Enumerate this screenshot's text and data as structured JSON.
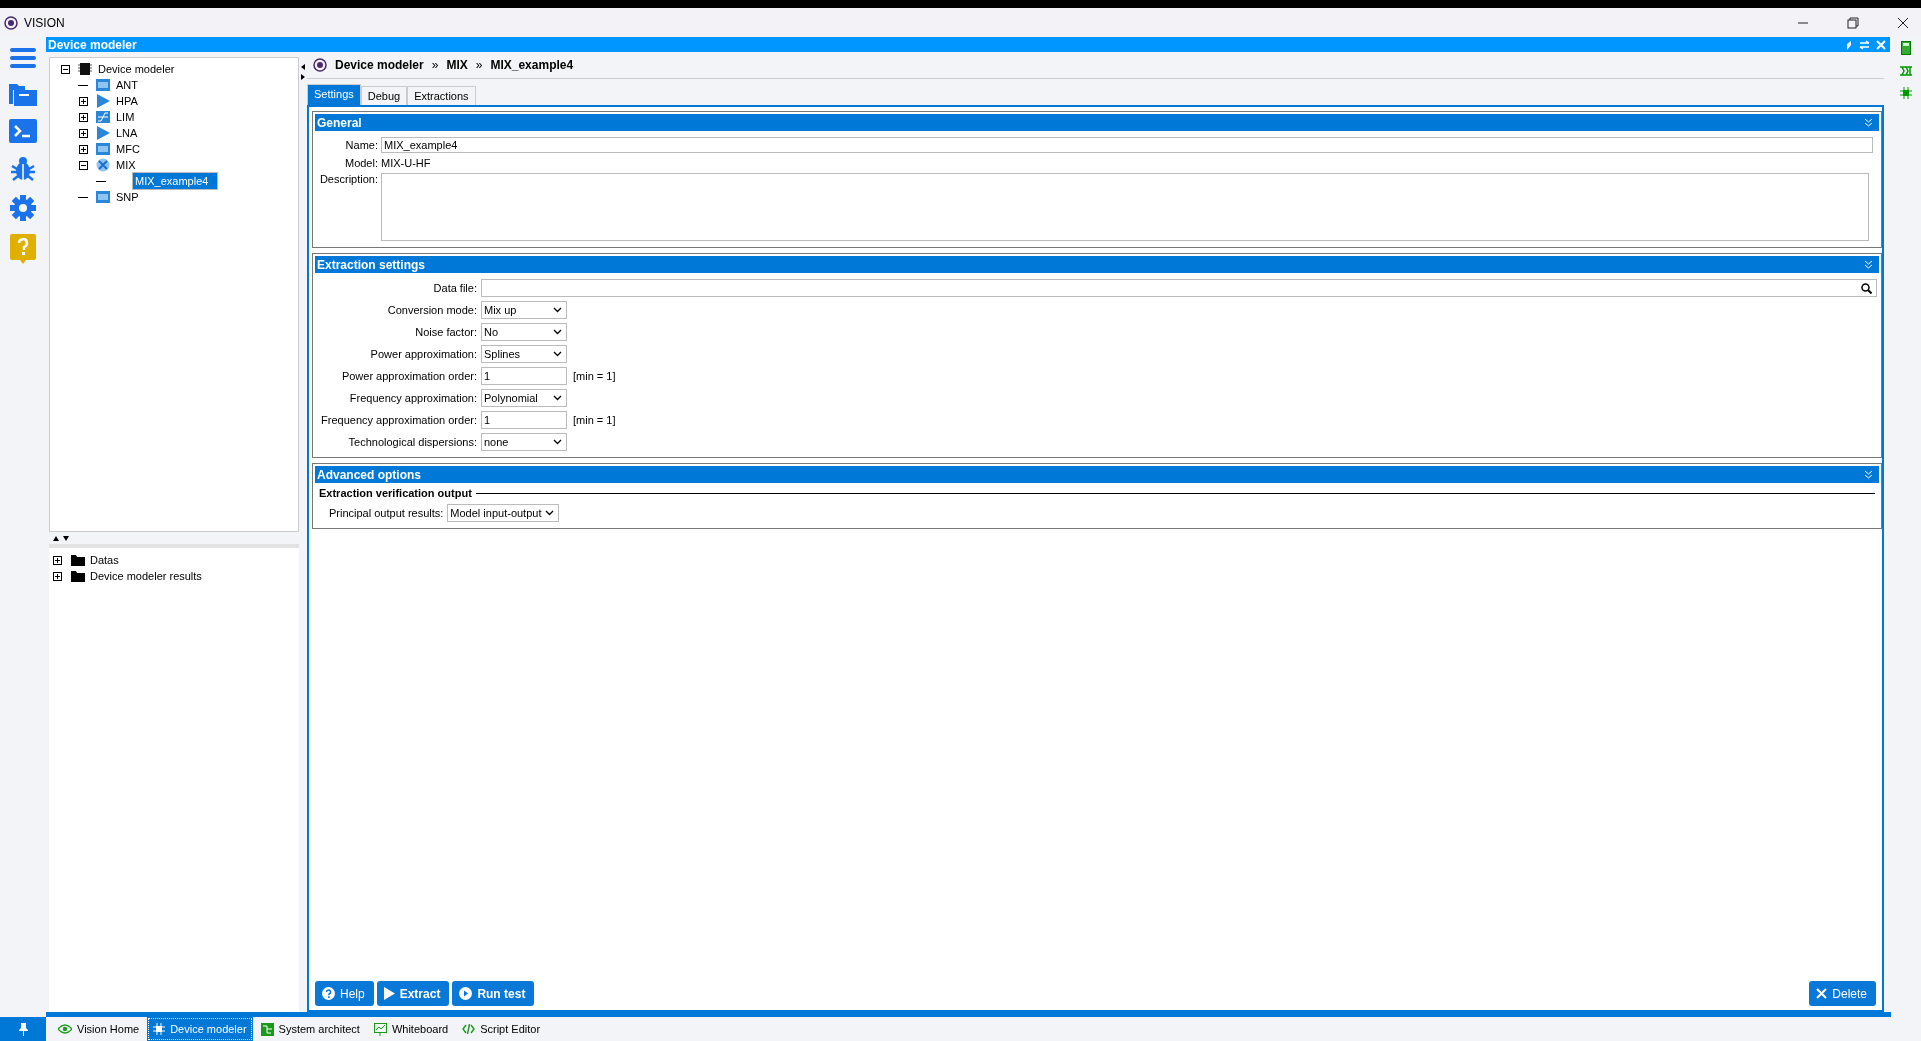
{
  "window": {
    "title": "VISION"
  },
  "panel": {
    "title": "Device modeler"
  },
  "tree": [
    {
      "label": "Device modeler",
      "kind": "chip",
      "expanded": true,
      "selected": false,
      "children": [
        {
          "label": "ANT",
          "kind": "s2p",
          "selected": false
        },
        {
          "label": "HPA",
          "kind": "amp",
          "expanded": false,
          "selected": false
        },
        {
          "label": "LIM",
          "kind": "limiter",
          "expanded": false,
          "selected": false
        },
        {
          "label": "LNA",
          "kind": "amp",
          "expanded": false,
          "selected": false
        },
        {
          "label": "MFC",
          "kind": "mfc",
          "expanded": false,
          "selected": false
        },
        {
          "label": "MIX",
          "kind": "mixer",
          "expanded": true,
          "selected": false,
          "children": [
            {
              "label": "MIX_example4",
              "selected": true
            }
          ]
        },
        {
          "label": "SNP",
          "kind": "s2p",
          "selected": false
        }
      ]
    }
  ],
  "lower_tree": [
    {
      "label": "Datas",
      "expanded": false
    },
    {
      "label": "Device modeler results",
      "expanded": false
    }
  ],
  "breadcrumb": {
    "items": [
      "Device modeler",
      "MIX",
      "MIX_example4"
    ],
    "separator": "»"
  },
  "tabs": [
    {
      "label": "Settings",
      "selected": true
    },
    {
      "label": "Debug",
      "selected": false
    },
    {
      "label": "Extractions",
      "selected": false
    }
  ],
  "general": {
    "title": "General",
    "name_label": "Name:",
    "name_value": "MIX_example4",
    "model_label": "Model:",
    "model_value": "MIX-U-HF",
    "description_label": "Description:"
  },
  "extraction": {
    "title": "Extraction settings",
    "fields": [
      {
        "kind": "file",
        "label": "Data file:"
      },
      {
        "kind": "select",
        "label": "Conversion mode:",
        "value": "Mix up"
      },
      {
        "kind": "select",
        "label": "Noise factor:",
        "value": "No"
      },
      {
        "kind": "select",
        "label": "Power approximation:",
        "value": "Splines"
      },
      {
        "kind": "number",
        "label": "Power approximation order:",
        "value": "1",
        "hint": "[min = 1]"
      },
      {
        "kind": "select",
        "label": "Frequency approximation:",
        "value": "Polynomial"
      },
      {
        "kind": "number",
        "label": "Frequency approximation order:",
        "value": "1",
        "hint": "[min = 1]"
      },
      {
        "kind": "select",
        "label": "Technological dispersions:",
        "value": "none"
      }
    ]
  },
  "advanced": {
    "title": "Advanced options",
    "group_title": "Extraction verification output",
    "fields": [
      {
        "kind": "select",
        "label": "Principal output results:",
        "value": "Model input-output"
      }
    ]
  },
  "buttons": [
    {
      "label": "Help",
      "kind": "help"
    },
    {
      "label": "Extract",
      "kind": "play"
    },
    {
      "label": "Run test",
      "kind": "circle-play"
    }
  ],
  "delete_button": {
    "label": "Delete"
  },
  "bottom_tabs": [
    {
      "label": "Vision Home",
      "kind": "eye",
      "selected": false
    },
    {
      "label": "Device modeler",
      "kind": "chip",
      "selected": true
    },
    {
      "label": "System architect",
      "kind": "diagram",
      "selected": false
    },
    {
      "label": "Whiteboard",
      "kind": "board",
      "selected": false
    },
    {
      "label": "Script Editor",
      "kind": "code",
      "selected": false
    }
  ]
}
